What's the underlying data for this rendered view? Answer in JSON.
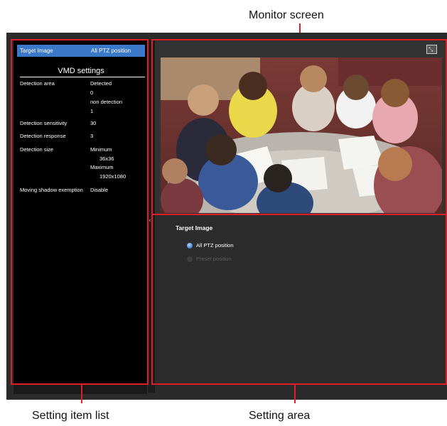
{
  "annotations": {
    "monitor_screen": "Monitor screen",
    "setting_item_list": "Setting item list",
    "setting_area": "Setting area"
  },
  "item_list": {
    "target_image_label": "Target Image",
    "target_image_value": "All PTZ position",
    "section_title": "VMD settings",
    "detection_area": {
      "label": "Detection area",
      "values": [
        "Detected",
        "0",
        "non detection",
        "1"
      ]
    },
    "detection_sensitivity": {
      "label": "Detection sensitivity",
      "value": "30"
    },
    "detection_response": {
      "label": "Detection response",
      "value": "3"
    },
    "detection_size": {
      "label": "Detection size",
      "minimum_label": "Minimum",
      "minimum_value": "36x36",
      "maximum_label": "Maximum",
      "maximum_value": "1920x1080"
    },
    "moving_shadow": {
      "label": "Moving shadow exemption",
      "value": "Disable"
    }
  },
  "monitor": {
    "fullscreen_icon": "fullscreen-toggle-icon"
  },
  "setting_area": {
    "title": "Target Image",
    "options": [
      {
        "label": "All PTZ position",
        "selected": true,
        "enabled": true
      },
      {
        "label": "Preset position",
        "selected": false,
        "enabled": false
      }
    ]
  },
  "colors": {
    "highlight_blue": "#3a78c9",
    "annotation_red": "#e21d2a",
    "panel_black": "#000000",
    "panel_dark": "#2c2c2c"
  }
}
